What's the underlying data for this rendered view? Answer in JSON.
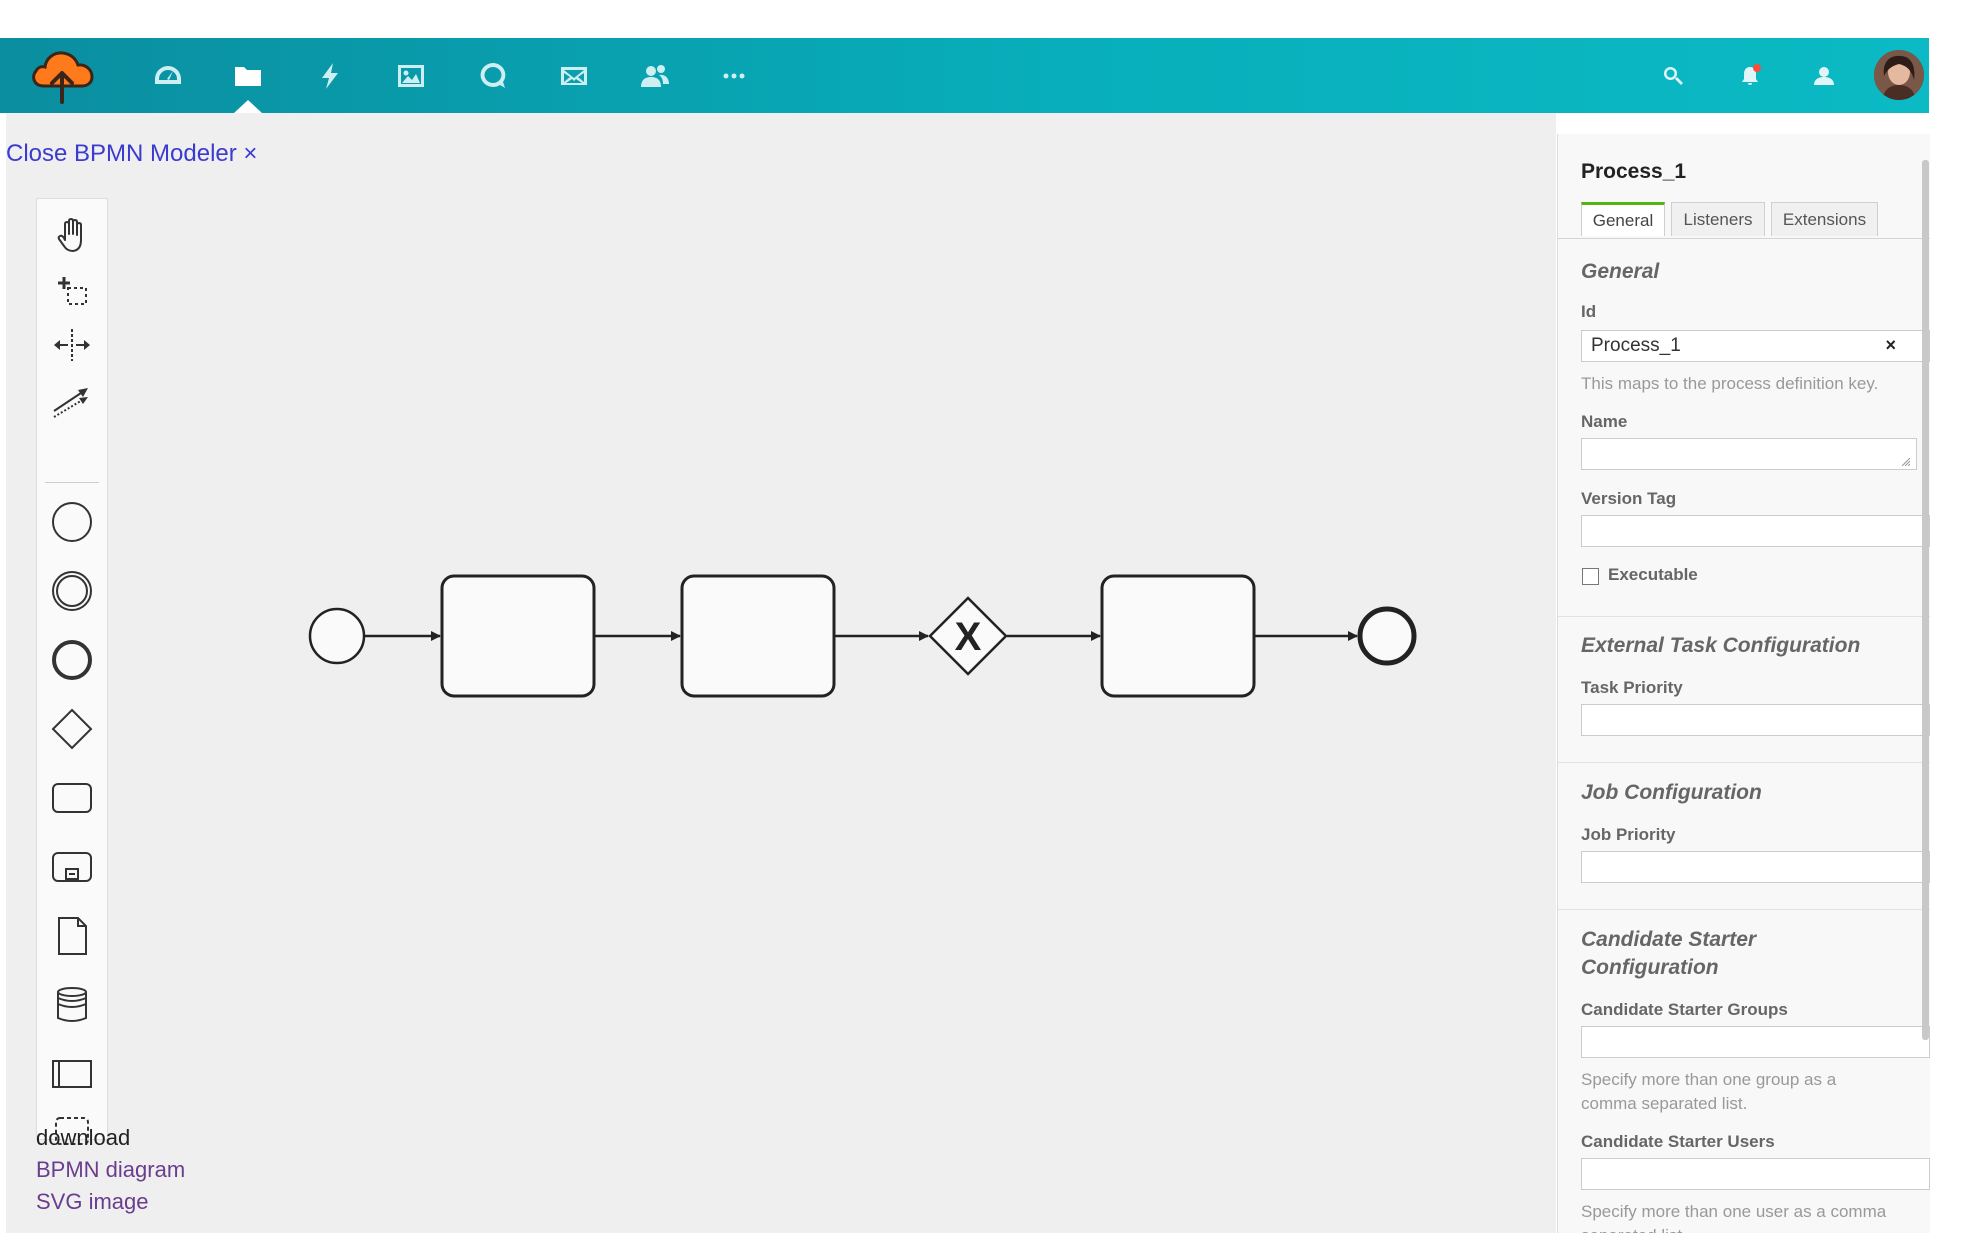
{
  "topbar": {
    "nav_icons": [
      "dashboard-icon",
      "folder-icon",
      "lightning-icon",
      "image-icon",
      "chat-icon",
      "mail-icon",
      "users-icon",
      "more-icon"
    ],
    "active_nav": "folder-icon",
    "right_icons": [
      "search-icon",
      "bell-icon",
      "user-icon"
    ],
    "accent_start": "#0a8ea0",
    "accent_end": "#0bbac4",
    "notification_dot_color": "#ff4b3a"
  },
  "canvas": {
    "close_link": "Close BPMN Modeler ×",
    "background": "#efefef",
    "palette_tools": [
      "hand-tool-icon",
      "lasso-tool-icon",
      "space-tool-icon",
      "connect-tool-icon",
      "start-event-icon",
      "intermediate-event-icon",
      "end-event-icon",
      "gateway-icon",
      "task-icon",
      "subprocess-icon",
      "data-object-icon",
      "data-store-icon",
      "pool-icon",
      "group-icon"
    ],
    "download": {
      "title": "download",
      "bpmn_link": "BPMN diagram",
      "svg_link": "SVG image"
    },
    "diagram_elements": [
      "start-event",
      "task",
      "task",
      "exclusive-gateway",
      "task",
      "end-event"
    ],
    "gateway_marker": "X"
  },
  "properties": {
    "title": "Process_1",
    "tabs": [
      "General",
      "Listeners",
      "Extensions"
    ],
    "active_tab": "General",
    "active_tab_color": "#52b415",
    "general": {
      "heading": "General",
      "id_label": "Id",
      "id_value": "Process_1",
      "id_hint": "This maps to the process definition key.",
      "name_label": "Name",
      "name_value": "",
      "version_label": "Version Tag",
      "version_value": "",
      "executable_label": "Executable",
      "executable_checked": false
    },
    "external_task": {
      "heading": "External Task Configuration",
      "priority_label": "Task Priority"
    },
    "job": {
      "heading": "Job Configuration",
      "priority_label": "Job Priority"
    },
    "candidate": {
      "heading": "Candidate Starter Configuration",
      "groups_label": "Candidate Starter Groups",
      "groups_hint": "Specify more than one group as a comma separated list.",
      "users_label": "Candidate Starter Users",
      "users_hint": "Specify more than one user as a comma separated list."
    }
  }
}
